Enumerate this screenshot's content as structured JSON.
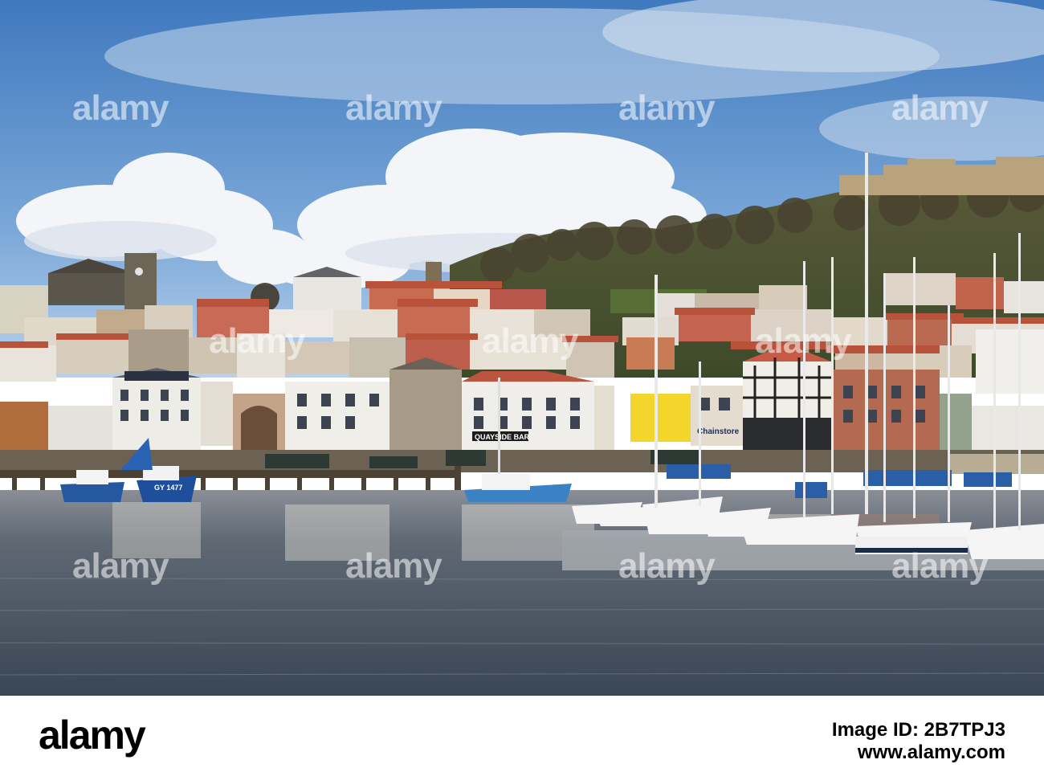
{
  "photo": {
    "description_icon": "harbour-photo",
    "signs": {
      "boat_left": "GY 1477",
      "shop_quayside": "QUAYSIDE BAR",
      "shop_chainstore": "Chainstore"
    }
  },
  "watermark": {
    "text": "alamy"
  },
  "footer": {
    "logo": "alamy",
    "image_id_prefix": "Image ID: ",
    "image_id": "2B7TPJ3",
    "url": "www.alamy.com"
  },
  "colors": {
    "sky_top": "#4f86c6",
    "sky_bottom": "#a9c7e8",
    "water": "#55606c",
    "roof_red": "#b8553d",
    "hill_green": "#4e5a33"
  }
}
